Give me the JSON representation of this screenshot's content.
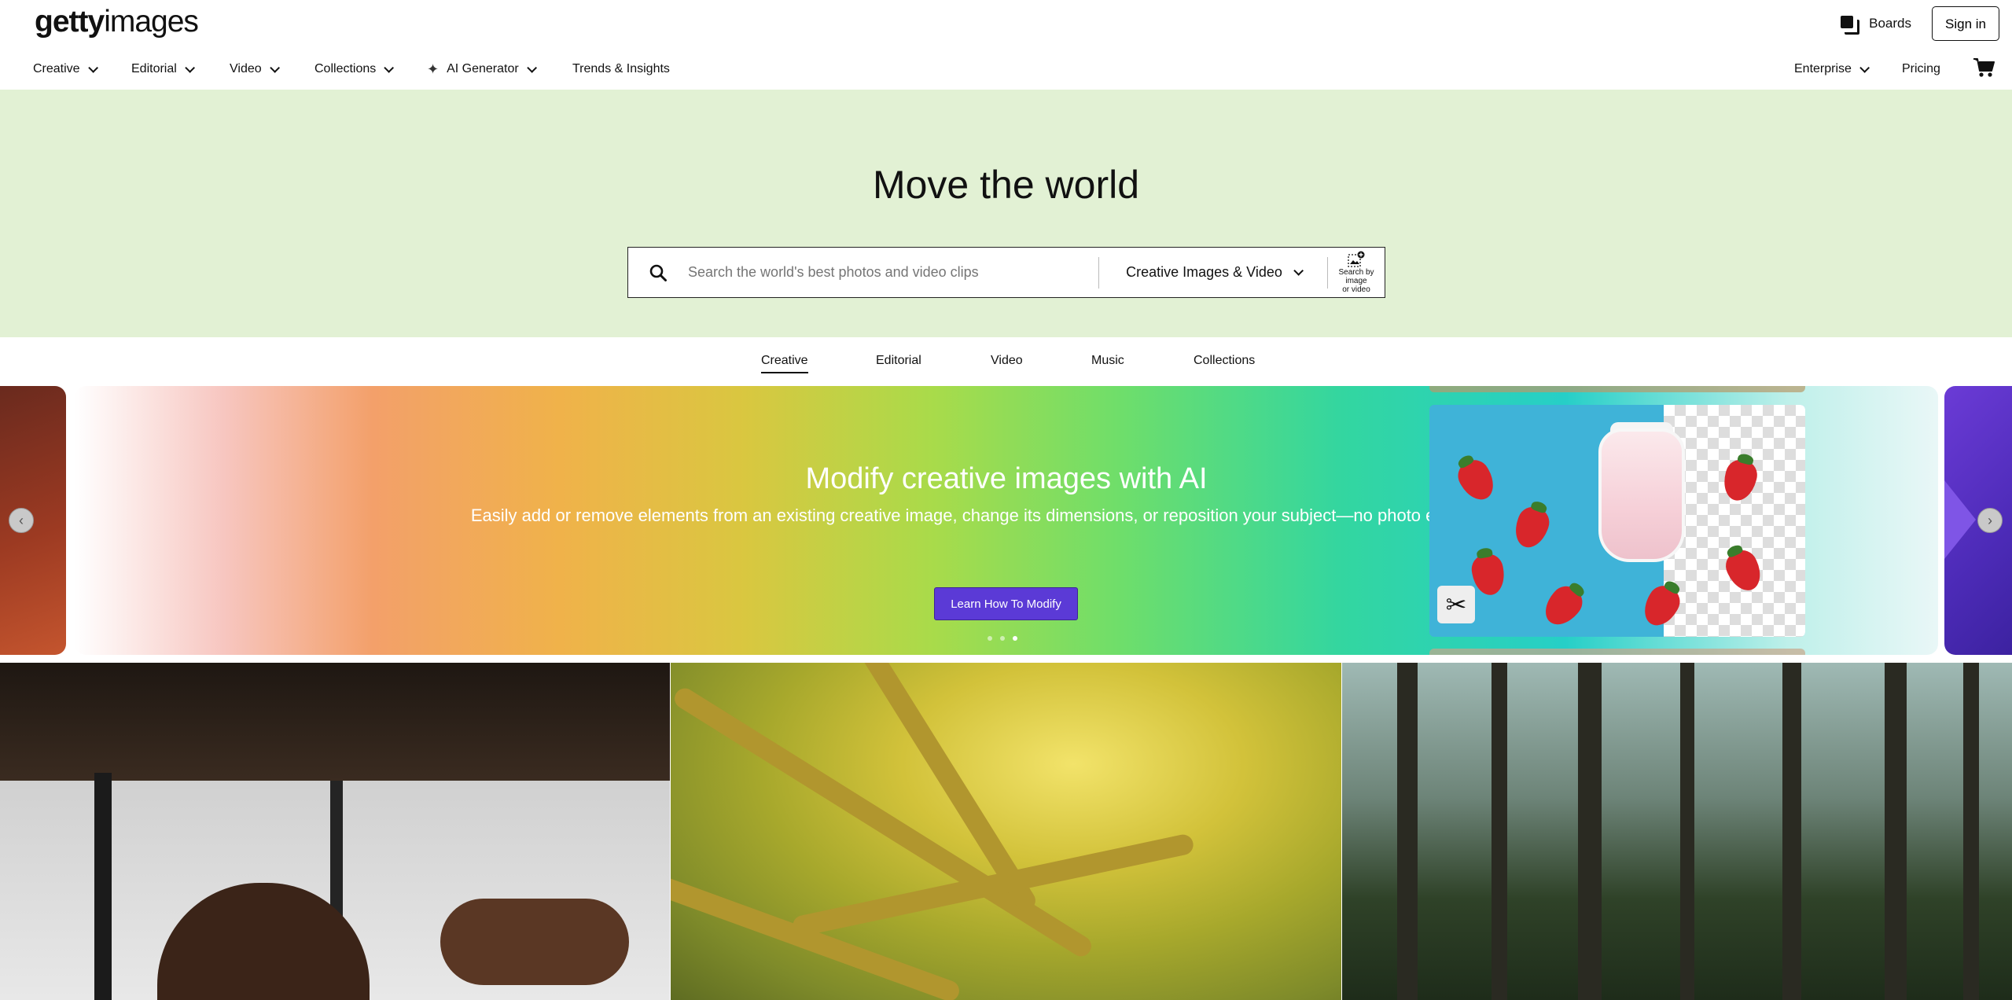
{
  "header": {
    "logo_bold": "getty",
    "logo_light": "images",
    "boards_label": "Boards",
    "signin_label": "Sign in"
  },
  "nav": {
    "creative": "Creative",
    "editorial": "Editorial",
    "video": "Video",
    "collections": "Collections",
    "ai_generator": "AI Generator",
    "trends": "Trends & Insights",
    "enterprise": "Enterprise",
    "pricing": "Pricing"
  },
  "hero": {
    "title": "Move the world",
    "search_placeholder": "Search the world's best photos and video clips",
    "scope_value": "Creative Images & Video",
    "image_search_line1": "Search by image",
    "image_search_line2": "or video",
    "background": "#e2f1d4"
  },
  "tabs": [
    {
      "label": "Creative",
      "active": true
    },
    {
      "label": "Editorial",
      "active": false
    },
    {
      "label": "Video",
      "active": false
    },
    {
      "label": "Music",
      "active": false
    },
    {
      "label": "Collections",
      "active": false
    }
  ],
  "promo": {
    "title": "Modify creative images with AI",
    "subtitle": "Easily add or remove elements from an existing creative image, change its dimensions, or reposition your subject—no photo editor required.",
    "button_label": "Learn How To Modify",
    "button_color": "#5b3ad6",
    "slide_count": 3,
    "active_slide": 3
  },
  "icons": {
    "search": "search-icon",
    "boards": "boards-icon",
    "cart": "cart-icon",
    "sparkle": "sparkle-icon",
    "scissors": "scissors-icon",
    "image_search": "image-search-icon"
  }
}
